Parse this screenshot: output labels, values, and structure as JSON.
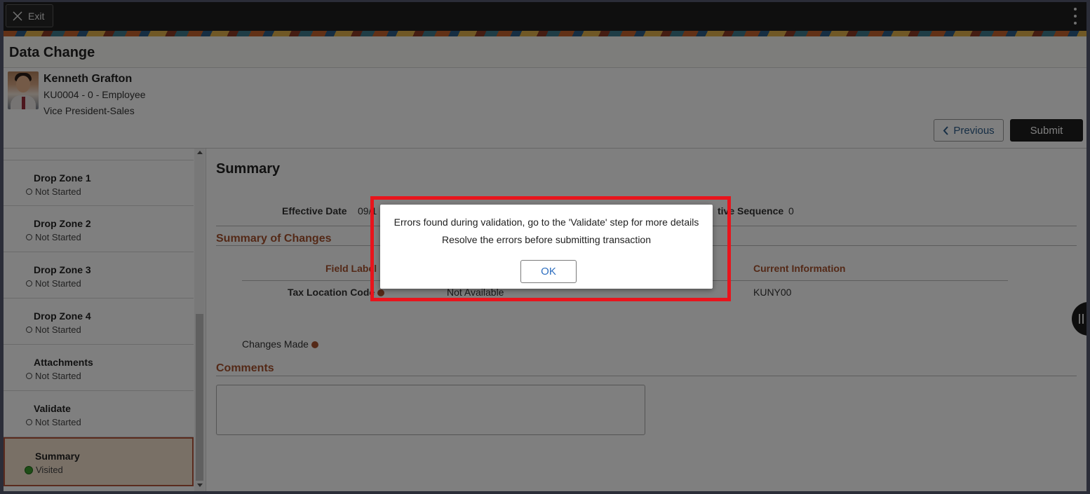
{
  "topbar": {
    "exit_label": "Exit"
  },
  "page": {
    "title": "Data Change"
  },
  "person": {
    "name": "Kenneth Grafton",
    "id_line": "KU0004 - 0 - Employee",
    "job_title": "Vice President-Sales"
  },
  "nav": {
    "previous_label": "Previous",
    "submit_label": "Submit"
  },
  "sidebar": {
    "steps": [
      {
        "name": "Drop Zone 1",
        "status": "Not Started"
      },
      {
        "name": "Drop Zone 2",
        "status": "Not Started"
      },
      {
        "name": "Drop Zone 3",
        "status": "Not Started"
      },
      {
        "name": "Drop Zone 4",
        "status": "Not Started"
      },
      {
        "name": "Attachments",
        "status": "Not Started"
      },
      {
        "name": "Validate",
        "status": "Not Started"
      },
      {
        "name": "Summary",
        "status": "Visited"
      }
    ]
  },
  "main": {
    "heading": "Summary",
    "effective_date_label": "Effective Date",
    "effective_date_value": "09/1",
    "effective_sequence_label": "tive Sequence",
    "effective_sequence_value": "0",
    "summary_of_changes_title": "Summary of Changes",
    "table": {
      "col_field_label": "Field Label",
      "col_current_info": "Current Information",
      "row": {
        "field": "Tax Location Code",
        "new_value": "Not Available",
        "current_value": "KUNY00"
      }
    },
    "changes_made_label": "Changes Made",
    "comments_title": "Comments"
  },
  "modal": {
    "line1": "Errors found during validation, go to the 'Validate' step for more details",
    "line2": "Resolve the errors before submitting transaction",
    "ok_label": "OK"
  },
  "colors": {
    "accent": "#a8532f",
    "active_step_bg": "#f3e0cc",
    "visited_green": "#3c9a2e",
    "highlight_red": "#e8141c"
  }
}
